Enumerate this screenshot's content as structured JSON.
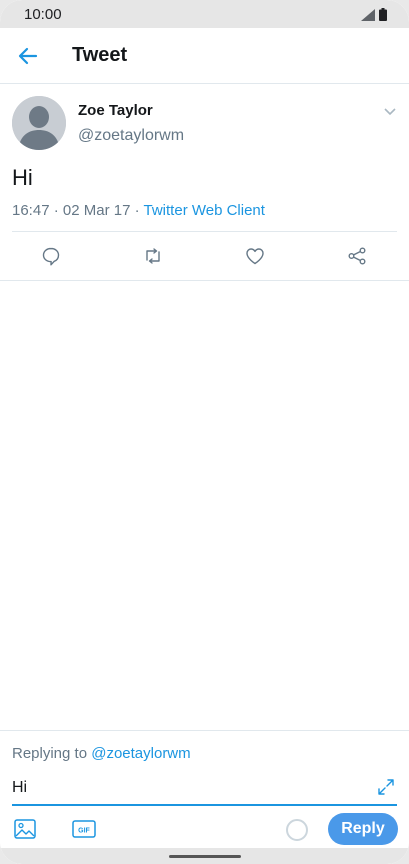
{
  "status_bar": {
    "time": "10:00"
  },
  "app_bar": {
    "title": "Tweet"
  },
  "tweet": {
    "display_name": "Zoe Taylor",
    "handle": "@zoetaylorwm",
    "text": "Hi",
    "time": "16:47",
    "date": "02 Mar 17",
    "source": "Twitter Web Client",
    "actions": [
      "reply-icon",
      "retweet-icon",
      "like-icon",
      "share-icon"
    ]
  },
  "composer": {
    "replying_prefix": "Replying to ",
    "replying_to": "@zoetaylorwm",
    "input_value": "Hi",
    "reply_label": "Reply"
  },
  "colors": {
    "accent": "#1b95e0",
    "reply_button": "#4a99e9",
    "secondary_text": "#657786"
  }
}
